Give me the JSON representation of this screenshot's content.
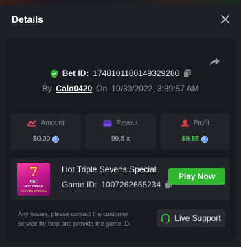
{
  "modal": {
    "title": "Details"
  },
  "bet": {
    "id_label": "Bet ID:",
    "id_value": "1748101180149329280",
    "by_label": "By",
    "username": "Calo0420",
    "on_label": "On",
    "datetime": "10/30/2022, 3:39:57 AM"
  },
  "stats": {
    "amount": {
      "label": "Amount",
      "value": "$0.00"
    },
    "payout": {
      "label": "Payout",
      "value": "99.5 x"
    },
    "profit": {
      "label": "Profit",
      "value": "$9.85"
    }
  },
  "game": {
    "name": "Hot Triple Sevens Special",
    "id_label": "Game ID:",
    "id_value": "1007262665234",
    "play_label": "Play Now",
    "thumb": {
      "seven": "7",
      "hot": "HOT",
      "line1": "HOT TRIPLE",
      "line2": "SEVENS SPECIAL"
    }
  },
  "support": {
    "help_text": "Any issues, please contact the customer service for help and provide the game ID.",
    "button_label": "Live Support"
  },
  "colors": {
    "accent_green": "#2fb82f",
    "profit_green": "#3ecf4a",
    "amount_icon": "#e0445a",
    "payout_icon": "#7b4cf0",
    "profit_icon": "#e03b3b"
  },
  "icons": [
    "close-icon",
    "share-icon",
    "shield-check-icon",
    "copy-icon",
    "amount-icon",
    "payout-icon",
    "profit-icon",
    "coin-icon",
    "headset-icon"
  ]
}
